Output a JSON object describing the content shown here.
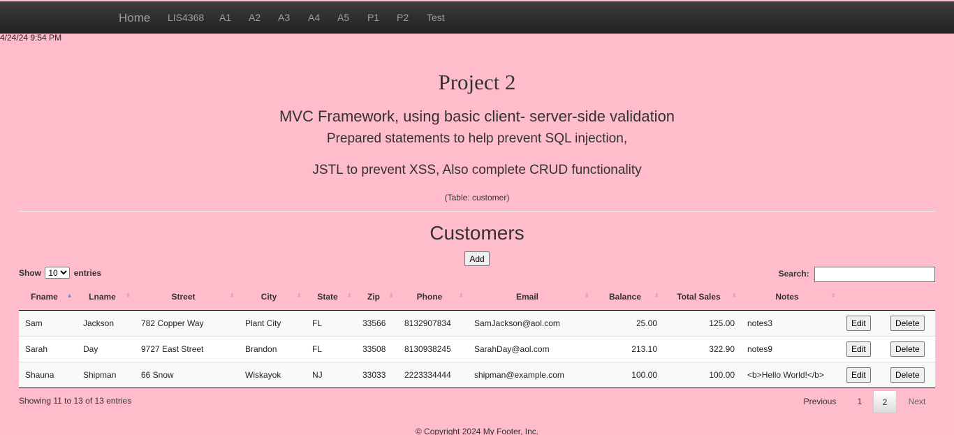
{
  "nav": {
    "home": "Home",
    "items": [
      "LIS4368",
      "A1",
      "A2",
      "A3",
      "A4",
      "A5",
      "P1",
      "P2",
      "Test"
    ]
  },
  "timestamp": "4/24/24 9:54 PM",
  "header": {
    "title": "Project 2",
    "subtitle1": "MVC Framework, using basic client- server-side validation",
    "subtitle2": "Prepared statements to help prevent SQL injection,",
    "subtitle3": "JSTL to prevent XSS, Also complete CRUD functionality",
    "table_name": "(Table: customer)"
  },
  "section_title": "Customers",
  "add_label": "Add",
  "controls": {
    "show_label": "Show",
    "show_value": "10",
    "entries_label": "entries",
    "search_label": "Search:",
    "search_value": ""
  },
  "table": {
    "columns": [
      "Fname",
      "Lname",
      "Street",
      "City",
      "State",
      "Zip",
      "Phone",
      "Email",
      "Balance",
      "Total Sales",
      "Notes"
    ],
    "sorted_column": "Fname",
    "rows": [
      [
        "Sam",
        "Jackson",
        "782 Copper Way",
        "Plant City",
        "FL",
        "33566",
        "8132907834",
        "SamJackson@aol.com",
        "25.00",
        "125.00",
        "notes3"
      ],
      [
        "Sarah",
        "Day",
        "9727 East Street",
        "Brandon",
        "FL",
        "33508",
        "8130938245",
        "SarahDay@aol.com",
        "213.10",
        "322.90",
        "notes9"
      ],
      [
        "Shauna",
        "Shipman",
        "66 Snow",
        "Wiskayok",
        "NJ",
        "33033",
        "2223334444",
        "shipman@example.com",
        "100.00",
        "100.00",
        "<b>Hello World!</b>"
      ]
    ],
    "edit_label": "Edit",
    "delete_label": "Delete"
  },
  "info": "Showing 11 to 13 of 13 entries",
  "pagination": {
    "previous": "Previous",
    "page1": "1",
    "page2": "2",
    "next": "Next",
    "current": "2"
  },
  "footer": "© Copyright 2024 My Footer, Inc.",
  "colors": {
    "background": "#ffbccb",
    "navbar": "#222222",
    "nav_text": "#9d9d9d"
  }
}
